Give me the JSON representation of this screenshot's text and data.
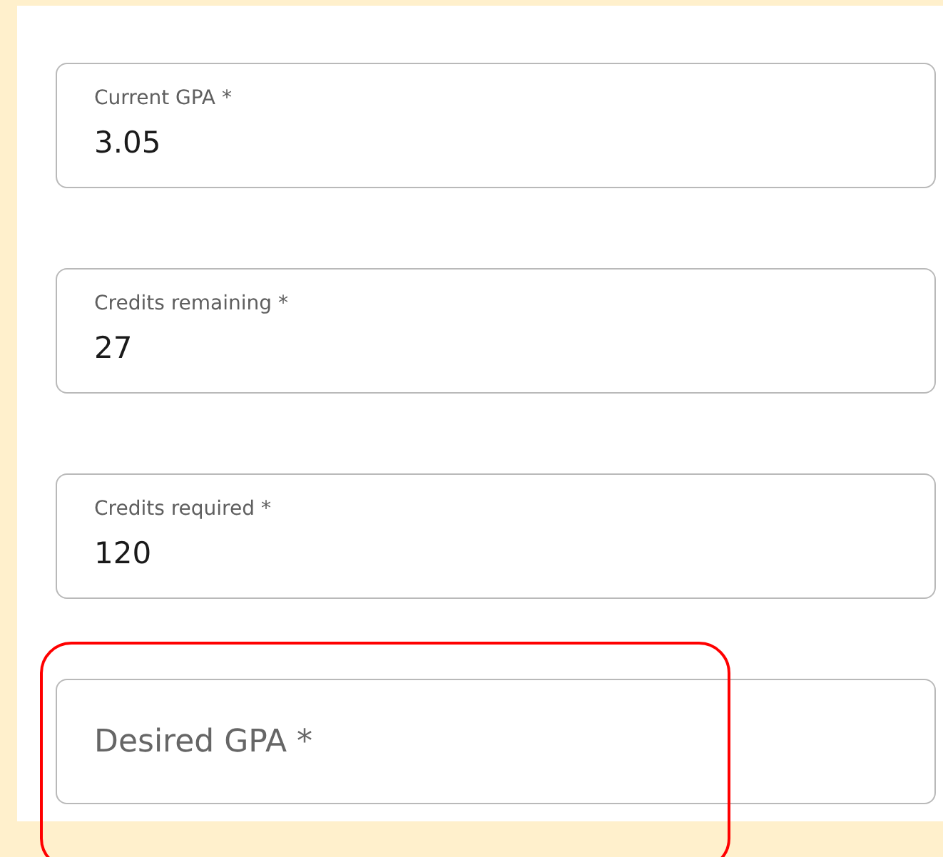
{
  "fields": [
    {
      "label": "Current GPA *",
      "value": "3.05",
      "highlighted": false
    },
    {
      "label": "Credits remaining *",
      "value": "27",
      "highlighted": false
    },
    {
      "label": "Credits required *",
      "value": "120",
      "highlighted": false
    },
    {
      "placeholder": "Desired GPA *",
      "highlighted": true
    }
  ]
}
